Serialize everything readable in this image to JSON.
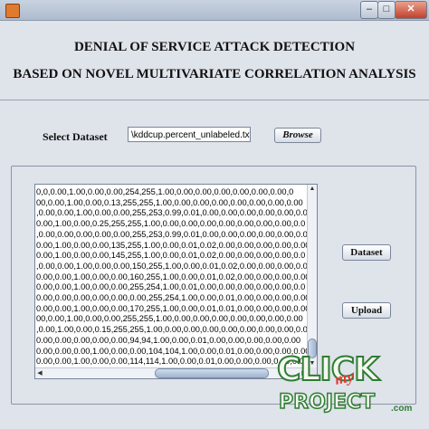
{
  "window": {
    "controls": {
      "minimize": "–",
      "maximize": "□",
      "close": "✕"
    }
  },
  "header": {
    "title_line1": "DENIAL OF SERVICE ATTACK DETECTION",
    "title_line2": "BASED ON NOVEL MULTIVARIATE CORRELATION ANALYSIS"
  },
  "dataset_selector": {
    "label": "Select Dataset",
    "path_value": "\\kddcup.percent_unlabeled.txt",
    "browse_label": "Browse"
  },
  "buttons": {
    "dataset_label": "Dataset",
    "upload_label": "Upload"
  },
  "data_area": {
    "lines": [
      "0,0,0.00,1.00,0.00,0.00,254,255,1.00,0.00,0.00,0.00,0.00,0.00,0.00,0",
      "00,0.00,1.00,0.00,0.13,255,255,1.00,0.00,0.00,0.00,0.00,0.00,0.00,0.00",
      ",0.00,0.00,1.00,0.00,0.00,255,253,0.99,0.01,0.00,0.00,0.00,0.00,0.00,0.00",
      "0.00,1.00,0.00,0.25,255,255,1.00,0.00,0.00,0.00,0.00,0.00,0.00,0.00,0.0",
      ",0.00,0.00,0.00,0.00,0.00,255,253,0.99,0.01,0.00,0.00,0.00,0.00,0.00,0.0",
      "0.00,1.00,0.00,0.00,135,255,1.00,0.00,0.01,0.02,0.00,0.00,0.00,0.00,0.00",
      "0.00,1.00,0.00,0.00,145,255,1.00,0.00,0.01,0.02,0.00,0.00,0.00,0.00,0.0",
      ",0.00,0.00,1.00,0.00,0.00,150,255,1.00,0.00,0.01,0.02,0.00,0.00,0.00,0.0",
      "0.00,0.00,1.00,0.00,0.00,160,255,1.00,0.00,0.01,0.02,0.00,0.00,0.00,0.00",
      "0.00,0.00,1.00,0.00,0.00,255,254,1.00,0.01,0.00,0.00,0.00,0.00,0.00,0.0",
      "0.00,0.00,0.00,0.00,0.00,0.00,255,254,1.00,0.00,0.01,0.00,0.00,0.00,0.00",
      "0.00,0.00,1.00,0.00,0.00,170,255,1.00,0.00,0.01,0.01,0.00,0.00,0.00,0.00",
      "00,0.00,1.00,0.00,0.00,255,255,1.00,0.00,0.00,0.00,0.00,0.00,0.00,0.00",
      ",0.00,1.00,0.00,0.15,255,255,1.00,0.00,0.00,0.00,0.00,0.00,0.00,0.00,0.0",
      "0.00,0.00,0.00,0.00,0.00,94,94,1.00,0.00,0.01,0.00,0.00,0.00,0.00,0.00",
      "0.00,0.00,0.00,1.00,0.00,0.00,104,104,1.00,0.00,0.01,0.00,0.00,0.00,0.00",
      "0.00,0.00,1.00,0.00,0.00,114,114,1.00,0.00,0.01,0.00,0.00,0.00,0.00,0.00",
      "0.00,1.00,0.00,0.25,122,122,1.00,0.00,0.01,0.00,0.00,0.00,0.00,0.00,0.00"
    ]
  },
  "watermark": {
    "word1": "CLICK",
    "word2": "my",
    "word3": "PROJECT",
    "suffix": ".com"
  }
}
